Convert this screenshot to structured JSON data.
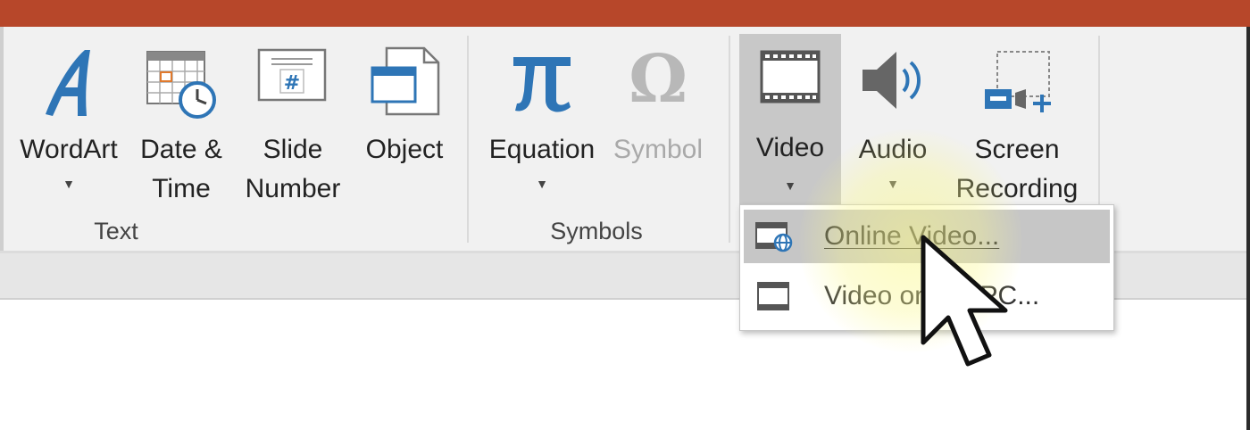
{
  "ribbon": {
    "groups": {
      "text": {
        "label": "Text"
      },
      "symbols": {
        "label": "Symbols"
      }
    },
    "buttons": {
      "wordart": {
        "label": "WordArt"
      },
      "date_time": {
        "label": "Date &\nTime"
      },
      "slide_number": {
        "label": "Slide\nNumber"
      },
      "object": {
        "label": "Object"
      },
      "equation": {
        "label": "Equation"
      },
      "symbol": {
        "label": "Symbol"
      },
      "video": {
        "label": "Video"
      },
      "audio": {
        "label": "Audio"
      },
      "screen_recording": {
        "label": "Screen\nRecording"
      }
    }
  },
  "video_menu": {
    "items": [
      {
        "label": "Online Video..."
      },
      {
        "label": "Video on My PC..."
      }
    ]
  },
  "colors": {
    "title_bar": "#b7472a",
    "accent_blue": "#2e75b6",
    "menu_hover": "#c6c6c6"
  }
}
